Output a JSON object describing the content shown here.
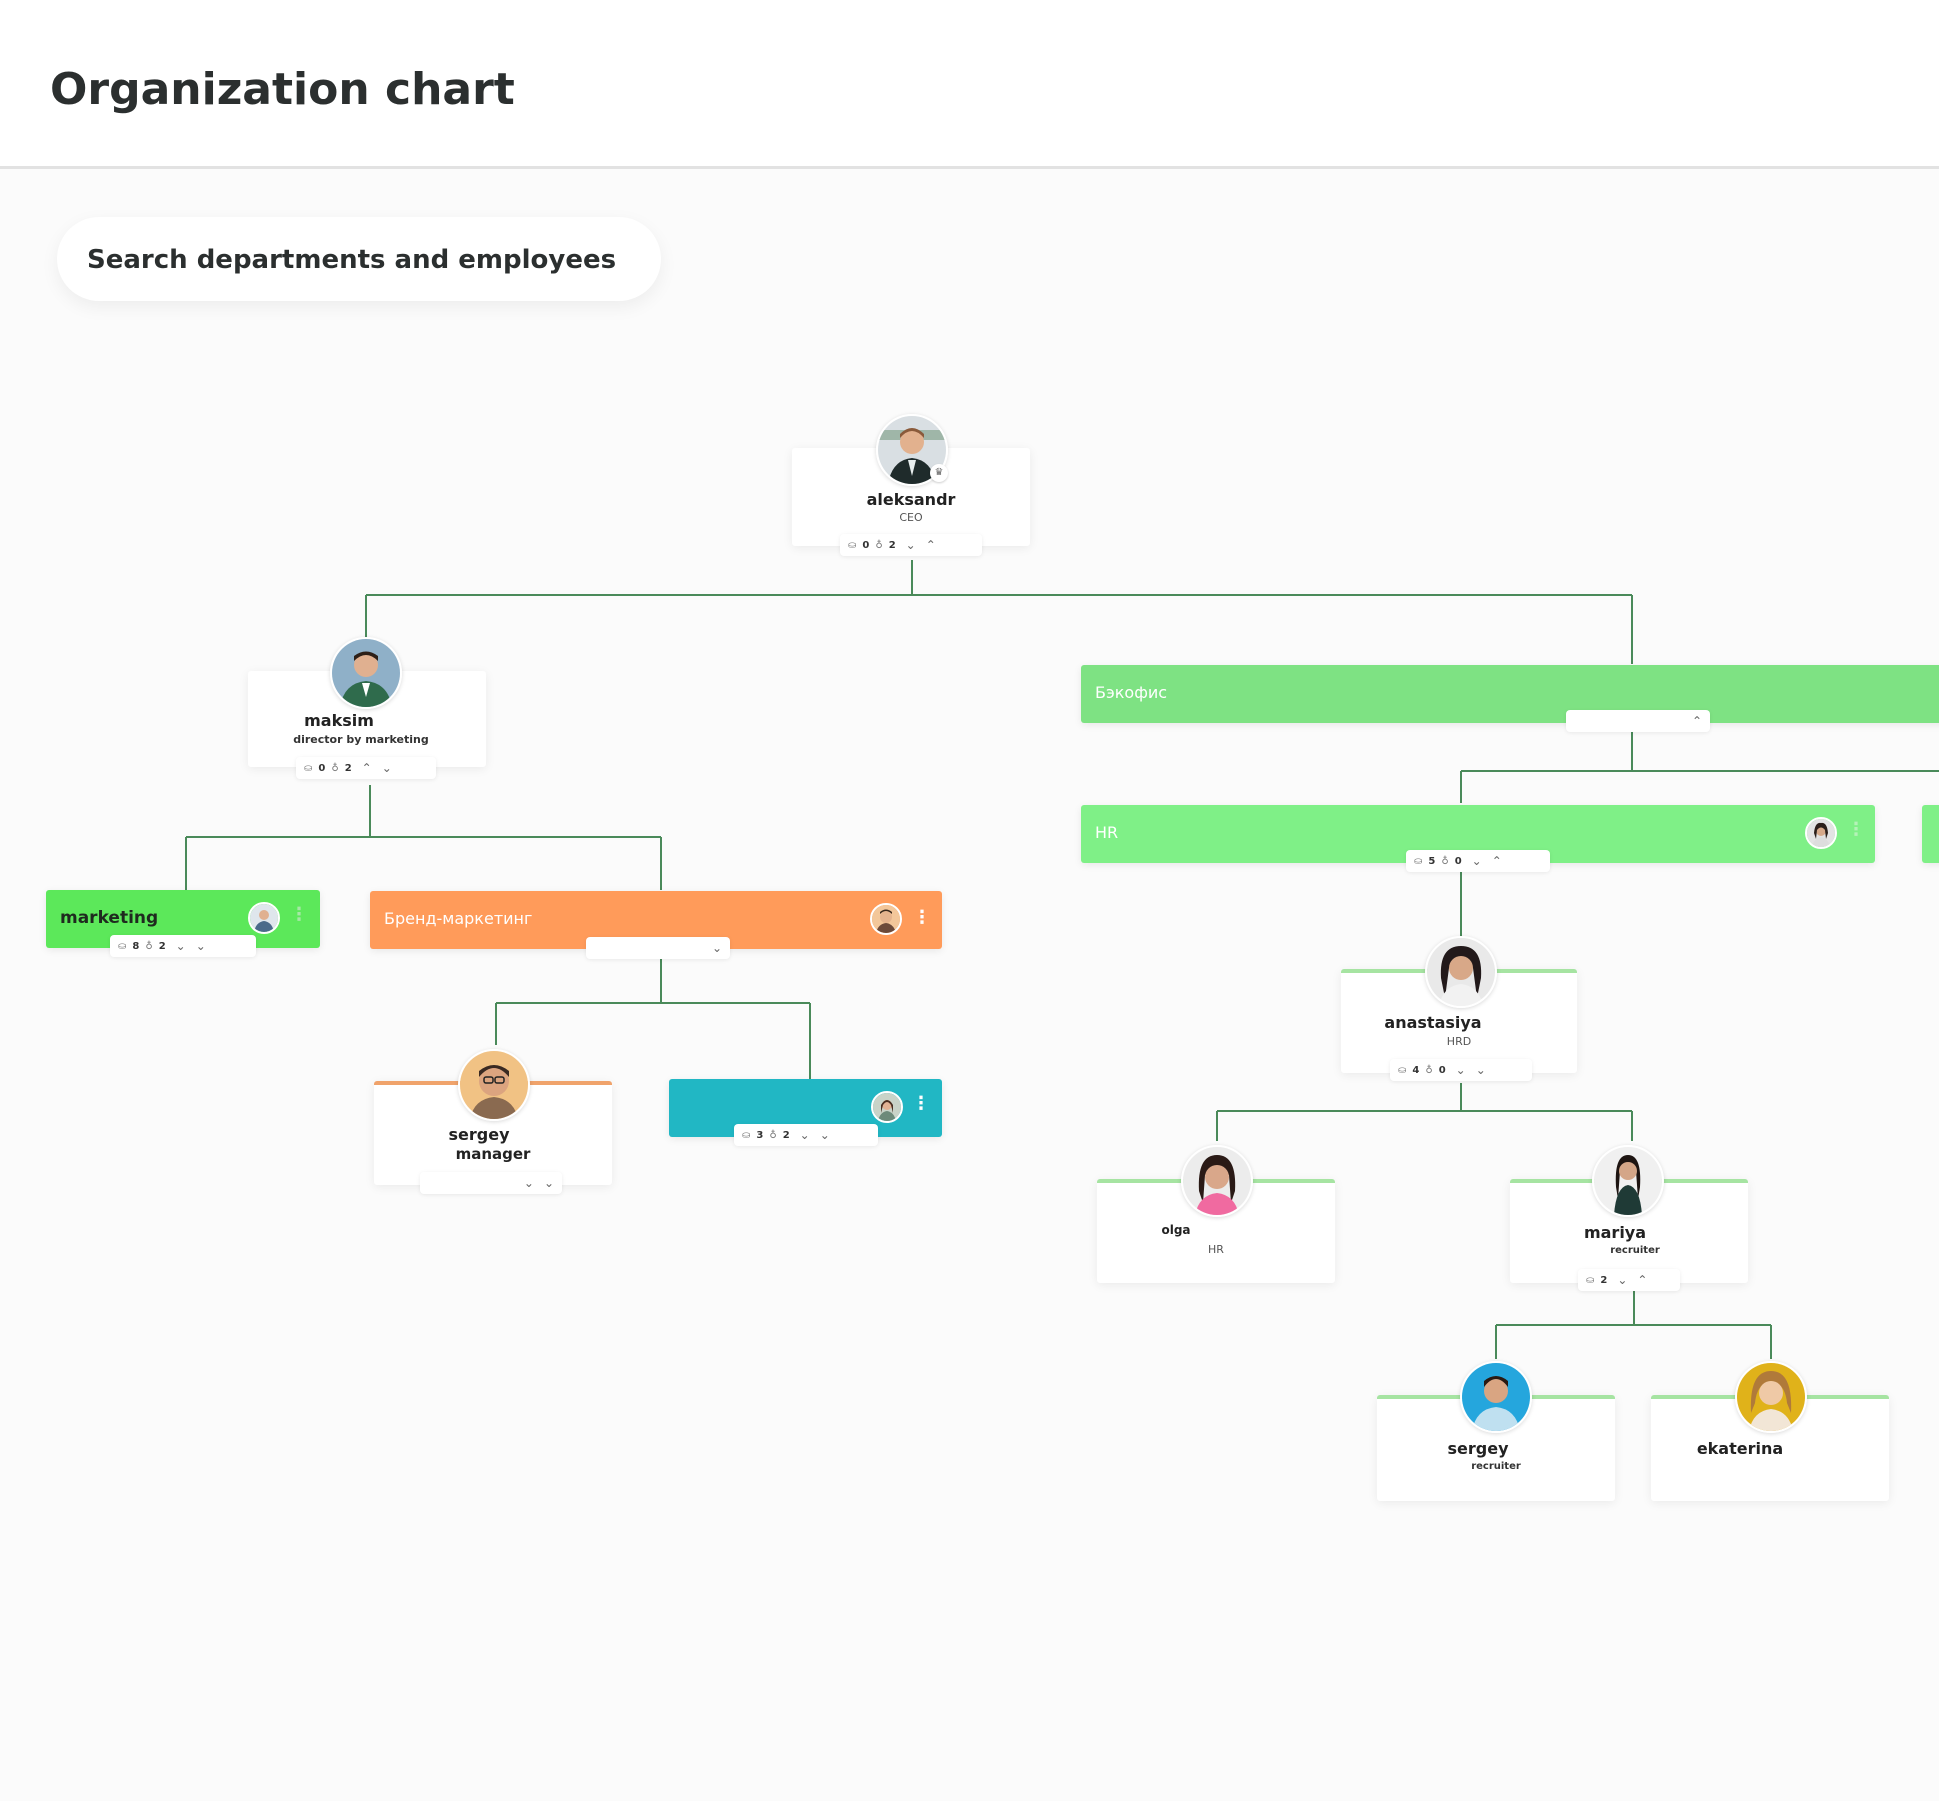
{
  "header": {
    "title": "Organization chart"
  },
  "search": {
    "label": "Search departments and employees"
  },
  "colors": {
    "line": "#4a8a5a",
    "green_light": "#7ff087",
    "green_medium": "#7ee283",
    "green_bright": "#5ce85a",
    "orange": "#ff9b5a",
    "teal": "#21b7c4",
    "page_bg": "#fbfbfb"
  },
  "icons": {
    "people": "people-icon",
    "hierarchy": "hierarchy-icon",
    "expand": "chevron-down-icon",
    "expand_all": "double-chevron-down-icon",
    "collapse_all": "double-chevron-up-icon",
    "menu": "kebab-menu-icon",
    "crown": "crown-icon"
  },
  "employees": {
    "aleksandr": {
      "name": "aleksandr",
      "role": "CEO",
      "staff": "0",
      "subs": "2"
    },
    "maksim": {
      "name": "maksim",
      "role": "director by marketing",
      "staff": "0",
      "subs": "2"
    },
    "sergey_manager": {
      "name": "sergey",
      "role": "manager"
    },
    "anastasiya": {
      "name": "anastasiya",
      "role": "HRD",
      "staff": "4",
      "subs": "0"
    },
    "olga": {
      "name": "olga",
      "role": "HR"
    },
    "mariya": {
      "name": "mariya",
      "role": "recruiter",
      "staff": "2"
    },
    "sergey_recruiter": {
      "name": "sergey",
      "role": "recruiter"
    },
    "ekaterina": {
      "name": "ekaterina"
    }
  },
  "departments": {
    "marketing": {
      "title": "marketing",
      "staff": "8",
      "subs": "2"
    },
    "brand": {
      "title": "Бренд-маркетинг"
    },
    "teal": {
      "title": "",
      "staff": "3",
      "subs": "2"
    },
    "backoffice": {
      "title": "Бэкофис"
    },
    "hr": {
      "title": "HR",
      "staff": "5",
      "subs": "0"
    }
  }
}
